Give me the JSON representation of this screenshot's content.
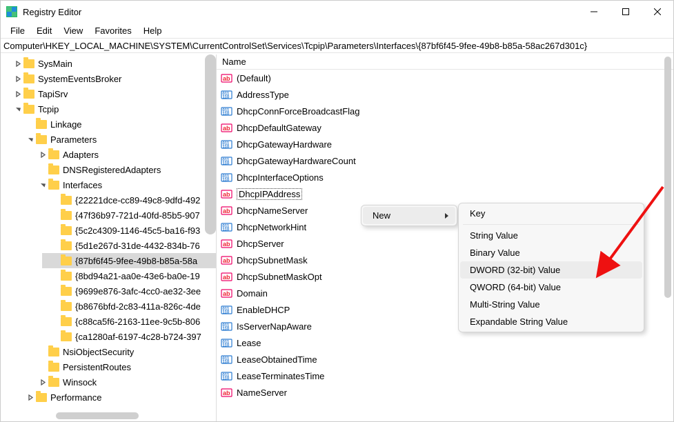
{
  "window": {
    "title": "Registry Editor"
  },
  "menubar": [
    "File",
    "Edit",
    "View",
    "Favorites",
    "Help"
  ],
  "addressbar": "Computer\\HKEY_LOCAL_MACHINE\\SYSTEM\\CurrentControlSet\\Services\\Tcpip\\Parameters\\Interfaces\\{87bf6f45-9fee-49b8-b85a-58ac267d301c}",
  "tree": [
    {
      "depth": 1,
      "exp": ">",
      "label": "SysMain"
    },
    {
      "depth": 1,
      "exp": ">",
      "label": "SystemEventsBroker"
    },
    {
      "depth": 1,
      "exp": ">",
      "label": "TapiSrv"
    },
    {
      "depth": 1,
      "exp": "v",
      "label": "Tcpip"
    },
    {
      "depth": 2,
      "exp": "",
      "label": "Linkage"
    },
    {
      "depth": 2,
      "exp": "v",
      "label": "Parameters"
    },
    {
      "depth": 3,
      "exp": ">",
      "label": "Adapters"
    },
    {
      "depth": 3,
      "exp": "",
      "label": "DNSRegisteredAdapters"
    },
    {
      "depth": 3,
      "exp": "v",
      "label": "Interfaces"
    },
    {
      "depth": 4,
      "exp": "",
      "label": "{22221dce-cc89-49c8-9dfd-492"
    },
    {
      "depth": 4,
      "exp": "",
      "label": "{47f36b97-721d-40fd-85b5-907"
    },
    {
      "depth": 4,
      "exp": "",
      "label": "{5c2c4309-1146-45c5-ba16-f93"
    },
    {
      "depth": 4,
      "exp": "",
      "label": "{5d1e267d-31de-4432-834b-76"
    },
    {
      "depth": 4,
      "exp": "",
      "label": "{87bf6f45-9fee-49b8-b85a-58a",
      "selected": true
    },
    {
      "depth": 4,
      "exp": "",
      "label": "{8bd94a21-aa0e-43e6-ba0e-19"
    },
    {
      "depth": 4,
      "exp": "",
      "label": "{9699e876-3afc-4cc0-ae32-3ee"
    },
    {
      "depth": 4,
      "exp": "",
      "label": "{b8676bfd-2c83-411a-826c-4de"
    },
    {
      "depth": 4,
      "exp": "",
      "label": "{c88ca5f6-2163-11ee-9c5b-806"
    },
    {
      "depth": 4,
      "exp": "",
      "label": "{ca1280af-6197-4c28-b724-397"
    },
    {
      "depth": 3,
      "exp": "",
      "label": "NsiObjectSecurity"
    },
    {
      "depth": 3,
      "exp": "",
      "label": "PersistentRoutes"
    },
    {
      "depth": 3,
      "exp": ">",
      "label": "Winsock"
    },
    {
      "depth": 2,
      "exp": ">",
      "label": "Performance"
    }
  ],
  "list": {
    "header": "Name",
    "rows": [
      {
        "type": "ab",
        "name": "(Default)"
      },
      {
        "type": "bin",
        "name": "AddressType"
      },
      {
        "type": "bin",
        "name": "DhcpConnForceBroadcastFlag"
      },
      {
        "type": "ab",
        "name": "DhcpDefaultGateway"
      },
      {
        "type": "bin",
        "name": "DhcpGatewayHardware"
      },
      {
        "type": "bin",
        "name": "DhcpGatewayHardwareCount"
      },
      {
        "type": "bin",
        "name": "DhcpInterfaceOptions"
      },
      {
        "type": "ab",
        "name": "DhcpIPAddress",
        "selected": true
      },
      {
        "type": "ab",
        "name": "DhcpNameServer"
      },
      {
        "type": "bin",
        "name": "DhcpNetworkHint"
      },
      {
        "type": "ab",
        "name": "DhcpServer"
      },
      {
        "type": "ab",
        "name": "DhcpSubnetMask"
      },
      {
        "type": "ab",
        "name": "DhcpSubnetMaskOpt"
      },
      {
        "type": "ab",
        "name": "Domain"
      },
      {
        "type": "bin",
        "name": "EnableDHCP"
      },
      {
        "type": "bin",
        "name": "IsServerNapAware"
      },
      {
        "type": "bin",
        "name": "Lease"
      },
      {
        "type": "bin",
        "name": "LeaseObtainedTime"
      },
      {
        "type": "bin",
        "name": "LeaseTerminatesTime"
      },
      {
        "type": "ab",
        "name": "NameServer"
      }
    ]
  },
  "context_menu1": {
    "items": [
      {
        "label": "New",
        "submenu": true
      }
    ]
  },
  "context_menu2": {
    "items": [
      {
        "label": "Key"
      },
      {
        "sep": true
      },
      {
        "label": "String Value"
      },
      {
        "label": "Binary Value"
      },
      {
        "label": "DWORD (32-bit) Value",
        "hov": true
      },
      {
        "label": "QWORD (64-bit) Value"
      },
      {
        "label": "Multi-String Value"
      },
      {
        "label": "Expandable String Value"
      }
    ]
  }
}
